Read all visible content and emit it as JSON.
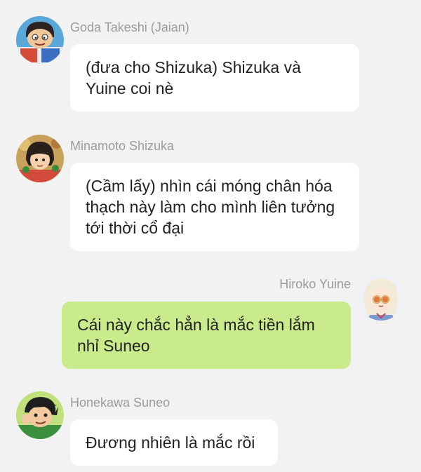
{
  "messages": [
    {
      "sender": "Goda Takeshi (Jaian)",
      "text": "(đưa cho Shizuka) Shizuka và Yuine coi nè",
      "side": "left",
      "avatar_icon": "jaian-avatar-icon"
    },
    {
      "sender": "Minamoto Shizuka",
      "text": "(Cầm lấy) nhìn cái móng chân hóa thạch này làm cho mình liên tưởng tới thời cổ đại",
      "side": "left",
      "avatar_icon": "shizuka-avatar-icon"
    },
    {
      "sender": "Hiroko Yuine",
      "text": "Cái này chắc hẳn là mắc tiền lắm nhỉ Suneo",
      "side": "right",
      "avatar_icon": "yuine-avatar-icon"
    },
    {
      "sender": "Honekawa Suneo",
      "text": "Đương nhiên là mắc rồi",
      "side": "left",
      "avatar_icon": "suneo-avatar-icon"
    }
  ],
  "colors": {
    "background": "#f2f2f3",
    "incoming_bubble": "#ffffff",
    "outgoing_bubble": "#c9eb8c",
    "sender_name": "#9b9b9b",
    "message_text": "#222222"
  }
}
